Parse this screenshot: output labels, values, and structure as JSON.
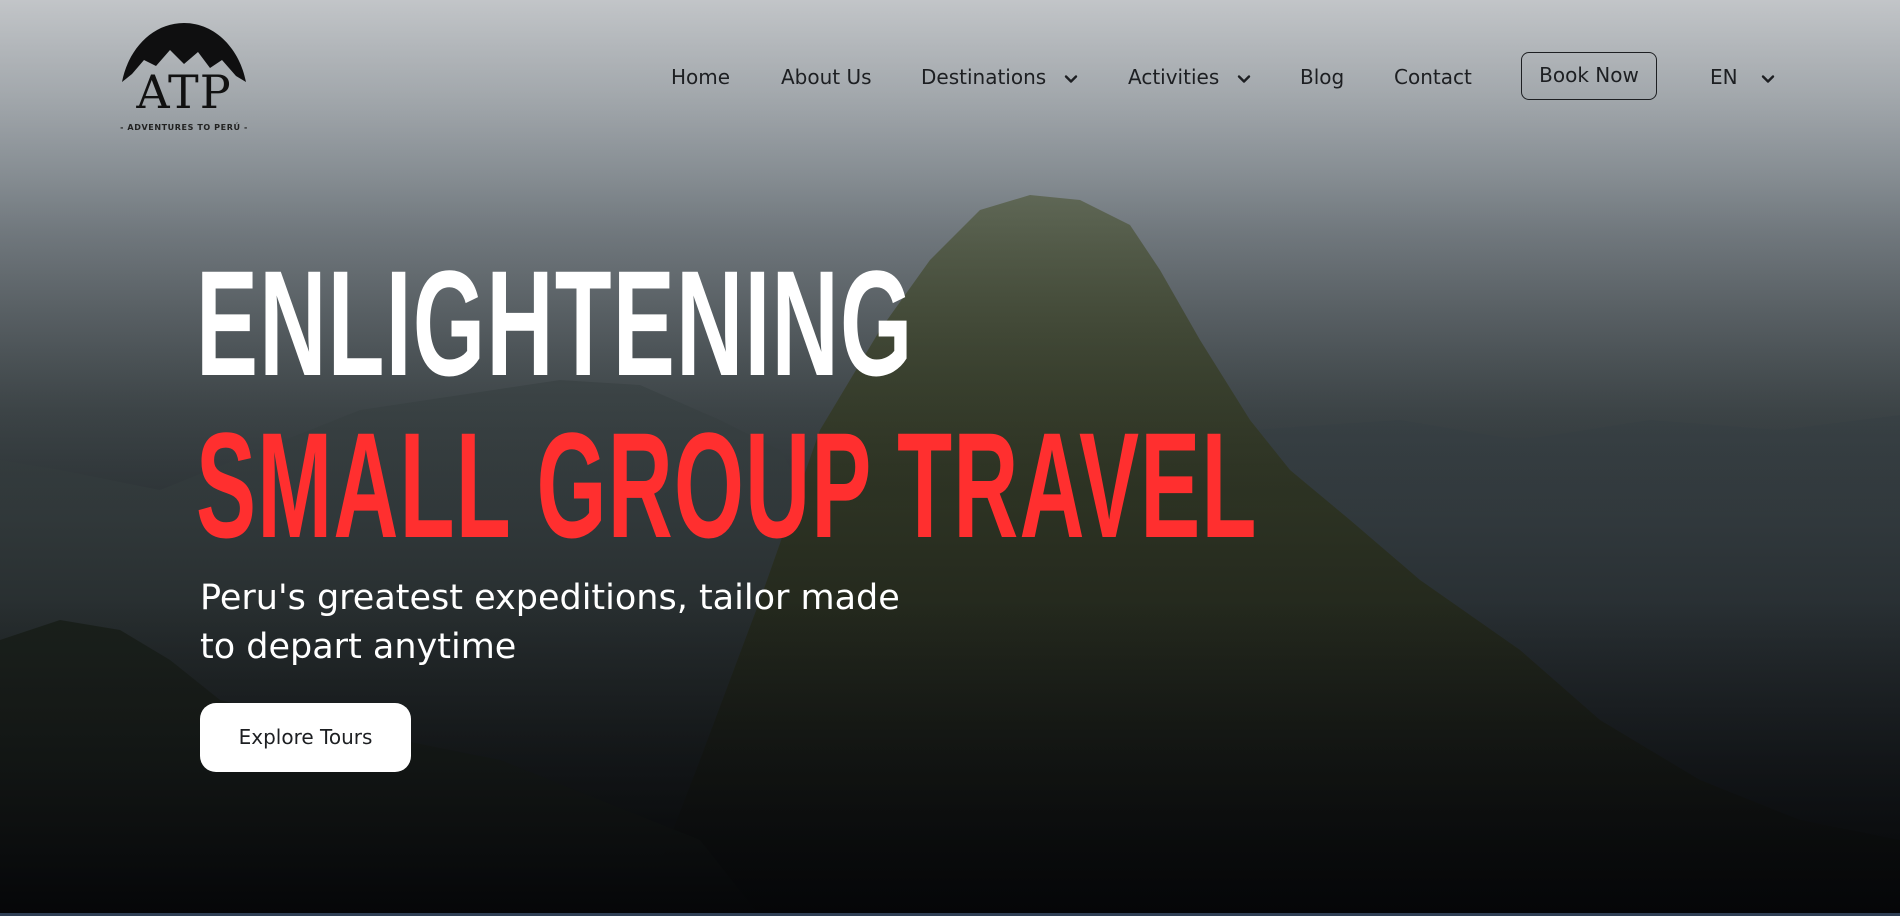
{
  "brand": {
    "logo_text": "ATP",
    "logo_subtitle": "- ADVENTURES TO PERÚ -"
  },
  "nav": {
    "items": [
      {
        "label": "Home",
        "has_dropdown": false
      },
      {
        "label": "About Us",
        "has_dropdown": false
      },
      {
        "label": "Destinations",
        "has_dropdown": true
      },
      {
        "label": "Activities",
        "has_dropdown": true
      },
      {
        "label": "Blog",
        "has_dropdown": false
      },
      {
        "label": "Contact",
        "has_dropdown": false
      }
    ],
    "book_now_label": "Book Now",
    "language": "EN"
  },
  "hero": {
    "headline_line1": "ENLIGHTENING",
    "headline_line2": "SMALL GROUP TRAVEL",
    "subtitle_line1": "Peru's greatest expeditions, tailor made",
    "subtitle_line2": "to depart anytime",
    "cta_label": "Explore Tours"
  },
  "colors": {
    "accent_red": "#ff2f2f",
    "headline_white": "#ffffff",
    "nav_text": "#1d1f22"
  },
  "icons": {
    "dropdown": "chevron-down-icon",
    "logo_mark": "mountain-logo-icon"
  }
}
